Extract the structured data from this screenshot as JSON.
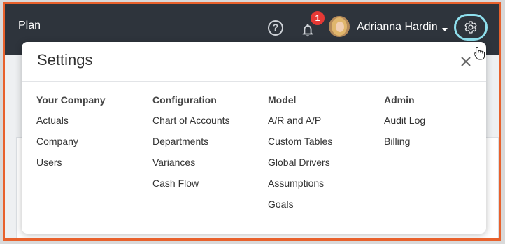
{
  "header": {
    "brand": "Plan",
    "help_icon_label": "?",
    "notification_count": "1",
    "user_name": "Adrianna Hardin"
  },
  "settings": {
    "title": "Settings",
    "columns": [
      {
        "heading": "Your Company",
        "items": [
          "Actuals",
          "Company",
          "Users"
        ]
      },
      {
        "heading": "Configuration",
        "items": [
          "Chart of Accounts",
          "Departments",
          "Variances",
          "Cash Flow"
        ]
      },
      {
        "heading": "Model",
        "items": [
          "A/R and A/P",
          "Custom Tables",
          "Global Drivers",
          "Assumptions",
          "Goals"
        ]
      },
      {
        "heading": "Admin",
        "items": [
          "Audit Log",
          "Billing"
        ]
      }
    ]
  },
  "colors": {
    "topbar": "#2e343c",
    "frame_border": "#e8612c",
    "gear_highlight": "#8fe0ee",
    "badge": "#e53935"
  },
  "icons": {
    "help": "help-circle-icon",
    "notifications": "bell-icon",
    "settings": "gear-icon",
    "close": "close-icon",
    "caret": "caret-down-icon",
    "cursor": "hand-pointer-icon"
  }
}
